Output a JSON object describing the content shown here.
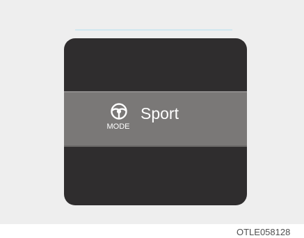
{
  "display": {
    "mode_label": "MODE",
    "selected_mode": "Sport",
    "icon": "steering-wheel-icon"
  },
  "caption": {
    "code": "OTLE058128"
  },
  "colors": {
    "background": "#eeeeee",
    "display": "#2f2d2e",
    "band": "#7a7877",
    "text": "#ffffff"
  }
}
